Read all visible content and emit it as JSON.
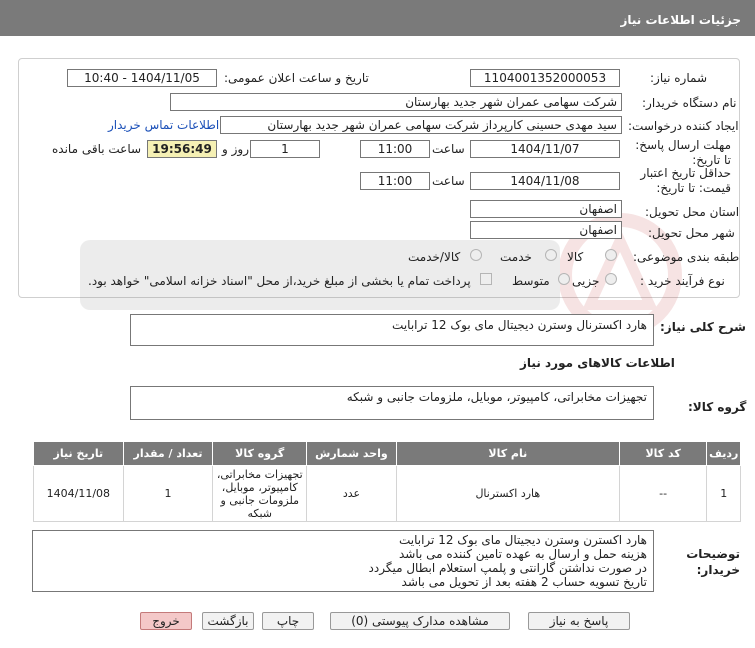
{
  "header": {
    "title": "جزئیات اطلاعات نیاز"
  },
  "form": {
    "need_number_label": "شماره نیاز:",
    "need_number": "1104001352000053",
    "announce_label": "تاریخ و ساعت اعلان عمومی:",
    "announce_value": "1404/11/05 - 10:40",
    "buyer_org_label": "نام دستگاه خریدار:",
    "buyer_org": "شرکت سهامی عمران شهر جدید بهارستان",
    "creator_label": "ایجاد کننده درخواست:",
    "creator": "سید مهدی حسینی کارپرداز شرکت سهامی عمران شهر جدید بهارستان",
    "contact_link": "اطلاعات تماس خریدار",
    "reply_deadline_label": "مهلت ارسال پاسخ: تا تاریخ:",
    "reply_date": "1404/11/07",
    "time_label": "ساعت",
    "reply_time": "11:00",
    "days_value": "1",
    "days_label": "روز و",
    "remaining_time": "19:56:49",
    "remaining_label": "ساعت باقی مانده",
    "price_validity_label": "حداقل تاریخ اعتبار قیمت: تا تاریخ:",
    "validity_date": "1404/11/08",
    "validity_time": "11:00",
    "province_label": "استان محل تحویل:",
    "province": "اصفهان",
    "city_label": "شهر محل تحویل:",
    "city": "اصفهان",
    "category_label": "طبقه بندی موضوعی:",
    "category_options": [
      "کالا",
      "خدمت",
      "کالا/خدمت"
    ],
    "process_label": "نوع فرآیند خرید :",
    "process_options": [
      "جزیی",
      "متوسط"
    ],
    "payment_note": "پرداخت تمام یا بخشی از مبلغ خرید،از محل \"اسناد خزانه اسلامی\" خواهد بود."
  },
  "summary": {
    "label": "شرح کلی نیاز:",
    "value": "هارد اکسترنال وسترن دیجیتال مای بوک 12 ترابایت"
  },
  "goods_info": {
    "title": "اطلاعات کالاهای مورد نیاز",
    "group_label": "گروه کالا:",
    "group_value": "تجهیزات مخابراتی، کامپیوتر، موبایل، ملزومات جانبی و شبکه"
  },
  "table": {
    "headers": [
      "ردیف",
      "کد کالا",
      "نام کالا",
      "واحد شمارش",
      "گروه کالا",
      "تعداد / مقدار",
      "تاریخ نیاز"
    ],
    "rows": [
      [
        "1",
        "--",
        "هارد اکسترنال",
        "عدد",
        "تجهیزات مخابراتی، کامپیوتر، موبایل، ملزومات جانبی و شبکه",
        "1",
        "1404/11/08"
      ]
    ]
  },
  "buyer_notes": {
    "label": "توضیحات خریدار:",
    "lines": [
      "هارد اکسترن وسترن دیجیتال مای بوک 12 ترابایت",
      "هزینه حمل و ارسال به عهده تامین کننده می باشد",
      "در صورت نداشتن گارانتی و پلمپ استعلام ابطال میگردد",
      "تاریخ تسویه حساب 2 هفته بعد از تحویل می باشد"
    ]
  },
  "buttons": {
    "reply": "پاسخ به نیاز",
    "attachments": "مشاهده مدارک پیوستی (0)",
    "print": "چاپ",
    "back": "بازگشت",
    "exit": "خروج"
  },
  "colors": {
    "header_bg": "#7a7a7a",
    "timer_bg": "#f5f0b4",
    "link": "#1a4fb8",
    "exit_btn": "#f4c8c8"
  }
}
